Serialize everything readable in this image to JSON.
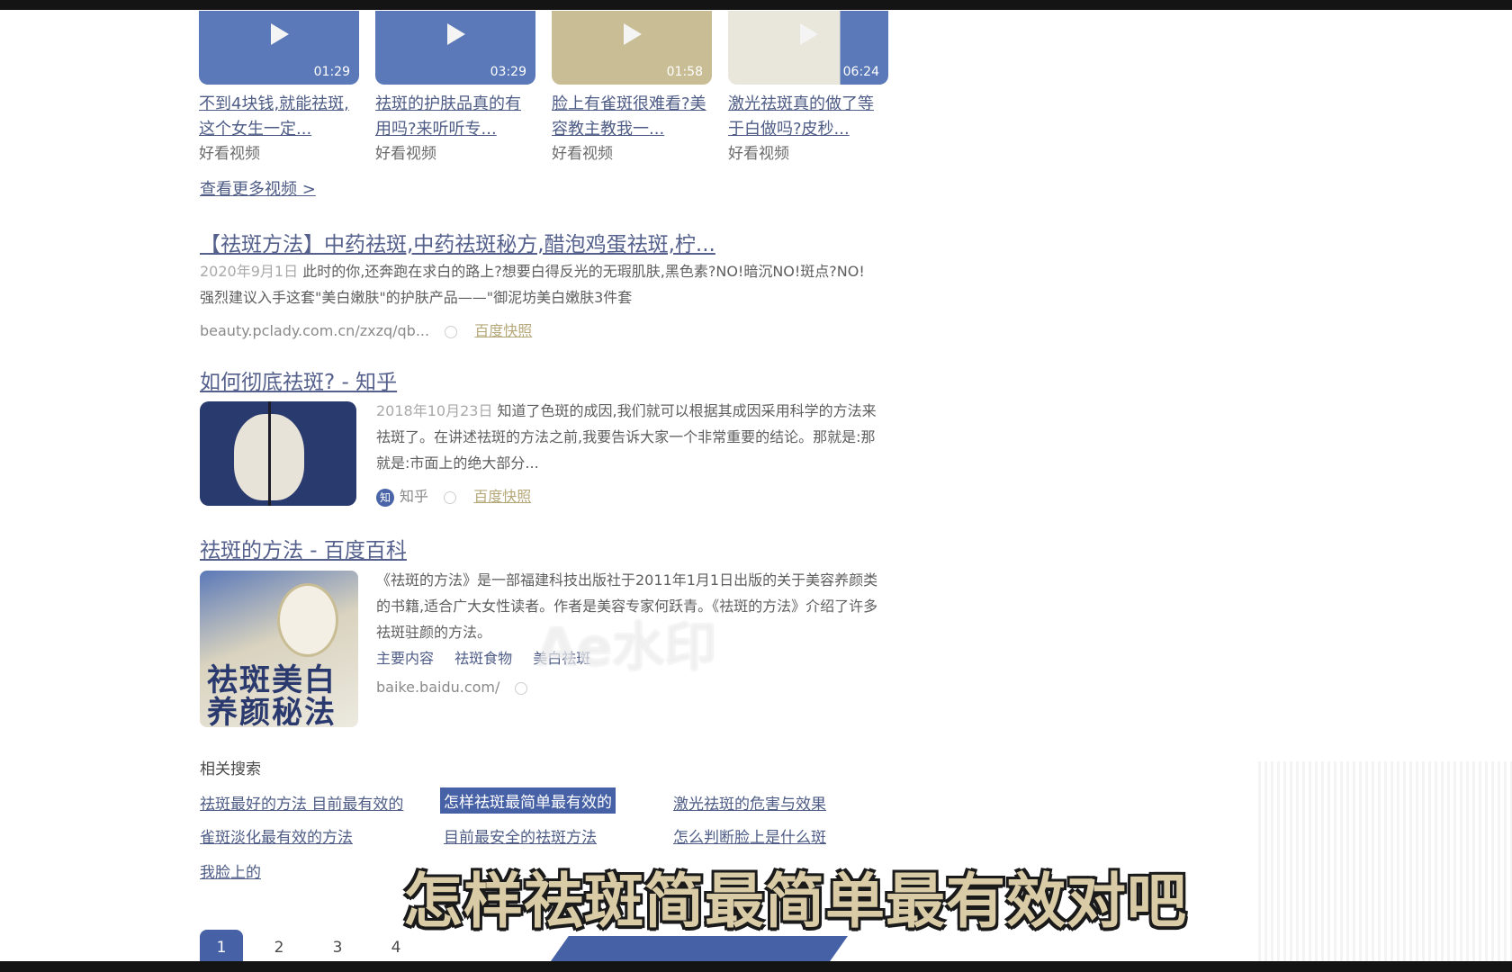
{
  "videos": [
    {
      "title": "不到4块钱,就能祛斑,这个女生一定...",
      "source": "好看视频",
      "duration": "01:29"
    },
    {
      "title": "祛斑的护肤品真的有用吗?来听听专...",
      "source": "好看视频",
      "duration": "03:29"
    },
    {
      "title": "脸上有雀斑很难看?美容教主教我一...",
      "source": "好看视频",
      "duration": "01:58"
    },
    {
      "title": "激光祛斑真的做了等于白做吗?皮秒...",
      "source": "好看视频",
      "duration": "06:24"
    }
  ],
  "more_videos_label": "查看更多视频 >",
  "results": [
    {
      "title": "【祛斑方法】中药祛斑,中药祛斑秘方,醋泡鸡蛋祛斑,柠...",
      "date": "2020年9月1日",
      "abstract": "此时的你,还奔跑在求白的路上?想要白得反光的无瑕肌肤,黑色素?NO!暗沉NO!斑点?NO!强烈建议入手这套\"美白嫩肤\"的护肤产品——\"御泥坊美白嫩肤3件套",
      "url": "beauty.pclady.com.cn/zxzq/qb...",
      "snapshot": "百度快照"
    },
    {
      "title": "如何彻底祛斑? - 知乎",
      "date": "2018年10月23日",
      "abstract": "知道了色斑的成因,我们就可以根据其成因采用科学的方法来祛斑了。在讲述祛斑的方法之前,我要告诉大家一个非常重要的结论。那就是:那就是:市面上的绝大部分...",
      "source": "知乎",
      "snapshot": "百度快照"
    },
    {
      "title": "祛斑的方法 - 百度百科",
      "abstract": "《祛斑的方法》是一部福建科技出版社于2011年1月1日出版的关于美容养颜类的书籍,适合广大女性读者。作者是美容专家何跃青。《祛斑的方法》介绍了许多祛斑驻颜的方法。",
      "tags": [
        "主要内容",
        "祛斑食物",
        "美白祛斑"
      ],
      "url": "baike.baidu.com/",
      "image_text": [
        "祛斑美白",
        "养颜秘法"
      ]
    }
  ],
  "watermark": "Ae水印",
  "related": {
    "heading": "相关搜索",
    "items": [
      "祛斑最好的方法 目前最有效的",
      "怎样祛斑最简单最有效的",
      "激光祛斑的危害与效果",
      "雀斑淡化最有效的方法",
      "目前最安全的祛斑方法",
      "怎么判断脸上是什么斑",
      "我脸上的"
    ],
    "selected_index": 1
  },
  "caption": "怎样祛斑简最简单最有效对吧",
  "pagination": [
    "1",
    "2",
    "3",
    "4"
  ],
  "current_page": "1",
  "colors": {
    "accent": "#4661a6",
    "link": "#4e5c86",
    "caption_fill": "#d9cba5",
    "bars": "#141414"
  }
}
